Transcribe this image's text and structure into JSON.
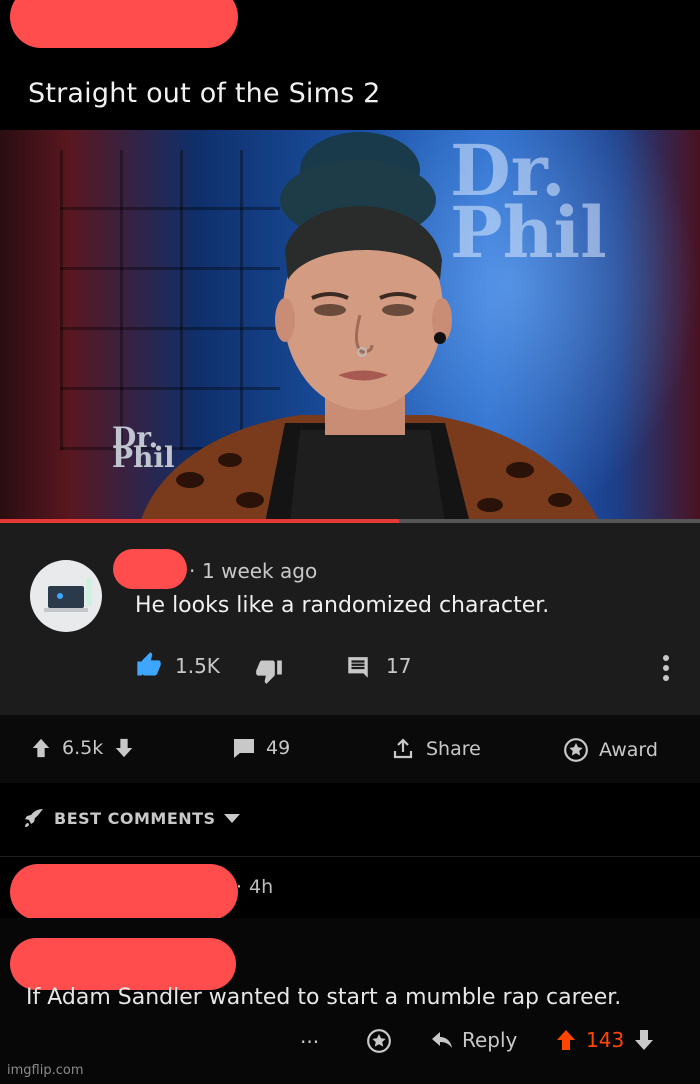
{
  "post": {
    "title": "Straight out of the Sims 2"
  },
  "video": {
    "logo_big": "Dr.\nPhil",
    "logo_small": "Dr.\nPhil",
    "progress": 0.57
  },
  "yt_comment": {
    "time": "1 week ago",
    "text": "He looks like a randomized character.",
    "likes": "1.5K",
    "replies": "17",
    "icons": [
      "like-icon",
      "dislike-icon",
      "reply-icon",
      "more-icon"
    ]
  },
  "post_actions": {
    "score": "6.5k",
    "comments": "49",
    "share_label": "Share",
    "award_label": "Award"
  },
  "sort": {
    "label": "BEST COMMENTS"
  },
  "comment": {
    "time": "4h",
    "text": "If Adam Sandler wanted to start a mumble rap career.",
    "more": "···",
    "reply_label": "Reply",
    "score": "143"
  },
  "watermark": "imgflip.com",
  "colors": {
    "redaction": "#ff4c4c",
    "upvote": "#ff4500",
    "yt_like": "#3ea6ff",
    "bg": "#000000"
  }
}
